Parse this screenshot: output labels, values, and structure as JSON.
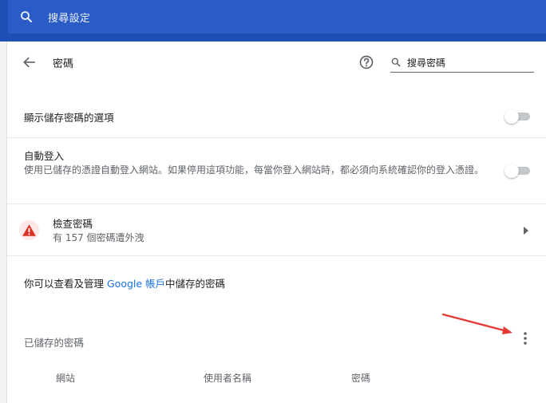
{
  "topbar": {
    "search_placeholder": "搜尋設定"
  },
  "header": {
    "title": "密碼",
    "search_placeholder": "搜尋密碼"
  },
  "settings": {
    "show_saved_password_options": {
      "label": "顯示儲存密碼的選項",
      "enabled": false
    },
    "auto_signin": {
      "label": "自動登入",
      "description": "使用已儲存的憑證自動登入網站。如果停用這項功能，每當你登入網站時，都必須向系統確認你的登入憑證。",
      "enabled": false
    },
    "check_passwords": {
      "label": "檢查密碼",
      "subtitle": "有 157 個密碼遭外洩"
    }
  },
  "info": {
    "prefix": "你可以查看及管理 ",
    "link_text": "Google 帳戶",
    "suffix": "中儲存的密碼"
  },
  "saved_passwords": {
    "title": "已儲存的密碼",
    "columns": [
      "網站",
      "使用者名稱",
      "密碼"
    ]
  },
  "colors": {
    "topbar_bg": "#1d4fb4",
    "accent_link": "#1a73e8",
    "warning_red": "#d93025",
    "annotation_arrow": "#e53935"
  },
  "icons": {
    "top_search": "search-icon",
    "back": "arrow-left-icon",
    "help": "help-circle-icon",
    "header_search": "search-icon",
    "warning": "warning-triangle-icon",
    "chevron": "chevron-right-icon",
    "more": "more-vertical-icon"
  }
}
